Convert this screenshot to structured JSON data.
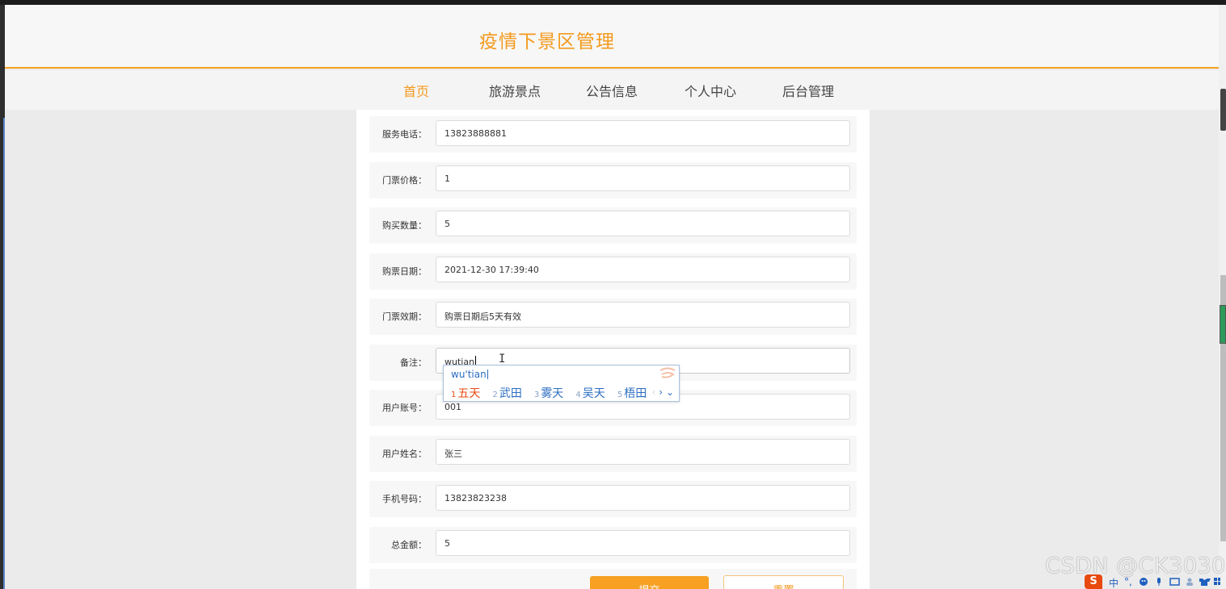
{
  "header": {
    "title": "疫情下景区管理"
  },
  "nav": {
    "items": [
      {
        "label": "首页",
        "active": true
      },
      {
        "label": "旅游景点",
        "active": false
      },
      {
        "label": "公告信息",
        "active": false
      },
      {
        "label": "个人中心",
        "active": false
      },
      {
        "label": "后台管理",
        "active": false
      }
    ]
  },
  "form": {
    "fields": [
      {
        "label": "服务电话：",
        "value": "13823888881"
      },
      {
        "label": "门票价格：",
        "value": "1"
      },
      {
        "label": "购买数量：",
        "value": "5"
      },
      {
        "label": "购票日期：",
        "value": "2021-12-30 17:39:40"
      },
      {
        "label": "门票效期：",
        "value": "购票日期后5天有效"
      },
      {
        "label": "备注：",
        "value": "wutian"
      },
      {
        "label": "用户账号：",
        "value": "001"
      },
      {
        "label": "用户姓名：",
        "value": "张三"
      },
      {
        "label": "手机号码：",
        "value": "13823823238"
      },
      {
        "label": "总金额：",
        "value": "5"
      }
    ],
    "submit_label": "提交",
    "reset_label": "重置"
  },
  "ime": {
    "pinyin": "wu'tian",
    "candidates": [
      {
        "num": "1",
        "word": "五天"
      },
      {
        "num": "2",
        "word": "武田"
      },
      {
        "num": "3",
        "word": "雾天"
      },
      {
        "num": "4",
        "word": "吴天"
      },
      {
        "num": "5",
        "word": "梧田"
      }
    ],
    "prev": "‹",
    "next": "›",
    "more": "⌄"
  },
  "watermark": "CSDN @CK3030",
  "tray": {
    "lang": "中",
    "punct": "°,"
  },
  "colors": {
    "accent": "#f39a1e",
    "ime_blue": "#2b6dc0",
    "ime_highlight": "#e8490f"
  }
}
